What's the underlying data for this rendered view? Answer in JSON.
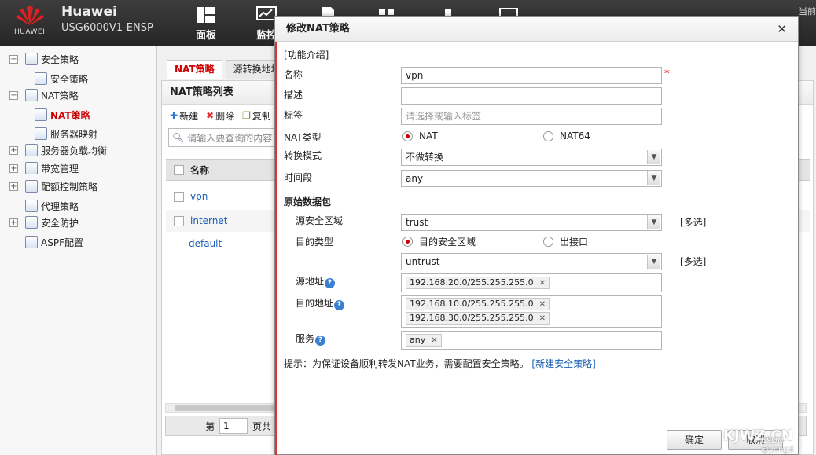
{
  "header": {
    "brand": "Huawei",
    "model": "USG6000V1-ENSP",
    "logo_text": "HUAWEI",
    "nav": [
      {
        "label": "面板",
        "icon": "dashboard-icon"
      },
      {
        "label": "监控",
        "icon": "monitor-icon"
      },
      {
        "label": "",
        "icon": "policy-icon"
      },
      {
        "label": "",
        "icon": "object-icon"
      },
      {
        "label": "",
        "icon": "network-icon"
      },
      {
        "label": "",
        "icon": "system-icon"
      }
    ],
    "right_text": "当前"
  },
  "sidebar": {
    "items": [
      {
        "label": "安全策略",
        "toggle": "−"
      },
      {
        "label": "安全策略",
        "toggle": ""
      },
      {
        "label": "NAT策略",
        "toggle": "−"
      },
      {
        "label": "NAT策略",
        "toggle": "",
        "active": true
      },
      {
        "label": "服务器映射",
        "toggle": ""
      },
      {
        "label": "服务器负载均衡",
        "toggle": "+"
      },
      {
        "label": "带宽管理",
        "toggle": "+"
      },
      {
        "label": "配额控制策略",
        "toggle": "+"
      },
      {
        "label": "代理策略",
        "toggle": ""
      },
      {
        "label": "安全防护",
        "toggle": "+"
      },
      {
        "label": "ASPF配置",
        "toggle": ""
      }
    ]
  },
  "main": {
    "tabs": [
      "NAT策略",
      "源转换地址"
    ],
    "panel_title": "NAT策略列表",
    "toolbar": {
      "new": "新建",
      "delete": "删除",
      "copy": "复制"
    },
    "search_placeholder": "请输入要查询的内容",
    "table": {
      "header": "名称",
      "rows": [
        "vpn",
        "internet",
        "default"
      ]
    },
    "pager": {
      "page_prefix": "第",
      "page_value": "1",
      "page_suffix": "页共"
    }
  },
  "dialog": {
    "title": "修改NAT策略",
    "help_link": "[功能介绍]",
    "name_label": "名称",
    "name_value": "vpn",
    "desc_label": "描述",
    "desc_value": "",
    "tag_label": "标签",
    "tag_placeholder": "请选择或输入标签",
    "nat_type_label": "NAT类型",
    "nat_type_opt1": "NAT",
    "nat_type_opt2": "NAT64",
    "mode_label": "转换模式",
    "mode_value": "不做转换",
    "time_label": "时间段",
    "time_value": "any",
    "section_title": "原始数据包",
    "src_zone_label": "源安全区域",
    "src_zone_value": "trust",
    "multi_link": "[多选]",
    "dst_type_label": "目的类型",
    "dst_type_opt1": "目的安全区域",
    "dst_type_opt2": "出接口",
    "dst_zone_value": "untrust",
    "src_addr_label": "源地址",
    "src_addr_tags": [
      "192.168.20.0/255.255.255.0"
    ],
    "dst_addr_label": "目的地址",
    "dst_addr_tags": [
      "192.168.10.0/255.255.255.0",
      "192.168.30.0/255.255.255.0"
    ],
    "service_label": "服务",
    "service_tags": [
      "any"
    ],
    "hint_text": "提示：为保证设备顺利转发NAT业务，需要配置安全策略。",
    "hint_link": "[新建安全策略]",
    "ok_label": "确定",
    "cancel_label": "取消"
  },
  "watermark": {
    "main": "KJWZ.CN",
    "sub": "CSDN @yengd"
  }
}
